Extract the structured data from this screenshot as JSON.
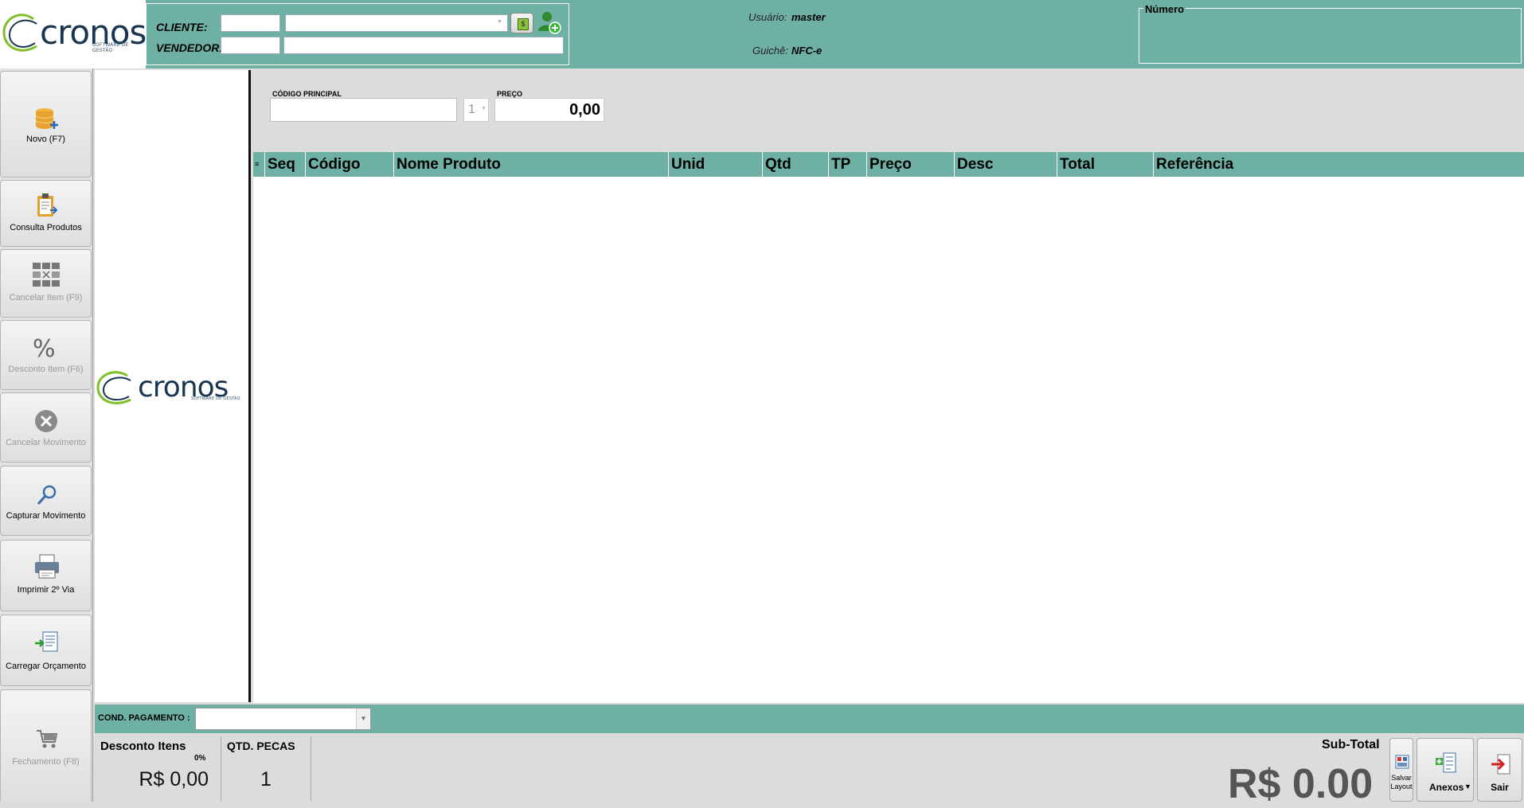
{
  "brand": {
    "name": "cronos",
    "tagline": "SOFTWARE DE GESTÃO"
  },
  "header": {
    "cliente_label": "CLIENTE:",
    "vendedor_label": "VENDEDOR:",
    "cliente_code": "",
    "cliente_name": "",
    "vendedor_code": "",
    "vendedor_name": "",
    "usuario_label": "Usuário:",
    "usuario_value": "master",
    "guiche_label": "Guichê:",
    "guiche_value": "NFC-e",
    "numero_label": "Número",
    "numero_value": ""
  },
  "sidebar": {
    "items": [
      {
        "label": "Novo (F7)",
        "icon": "database-add-icon",
        "enabled": true
      },
      {
        "label": "Consulta Produtos",
        "icon": "clipboard-icon",
        "enabled": true
      },
      {
        "label": "Cancelar Item (F9)",
        "icon": "grid-cancel-icon",
        "enabled": false
      },
      {
        "label": "Desconto Item (F6)",
        "icon": "percent-icon",
        "enabled": false
      },
      {
        "label": "Cancelar Movimento",
        "icon": "cancel-circle-icon",
        "enabled": false
      },
      {
        "label": "Capturar Movimento",
        "icon": "magnifier-icon",
        "enabled": true
      },
      {
        "label": "Imprimir 2º Via",
        "icon": "printer-icon",
        "enabled": true
      },
      {
        "label": "Carregar Orçamento",
        "icon": "document-load-icon",
        "enabled": true
      },
      {
        "label": "Fechamento (F8)",
        "icon": "cart-icon",
        "enabled": false
      }
    ]
  },
  "entry": {
    "codigo_label": "CÓDIGO PRINCIPAL",
    "codigo_value": "",
    "qty_value": "1",
    "preco_label": "PREÇO",
    "preco_value": "0,00"
  },
  "grid": {
    "columns": [
      "Seq",
      "Código",
      "Nome Produto",
      "Unid",
      "Qtd",
      "TP",
      "Preço",
      "Desc",
      "Total",
      "Referência"
    ],
    "rows": []
  },
  "payment": {
    "label": "COND. PAGAMENTO :",
    "value": ""
  },
  "totals": {
    "desconto_label": "Desconto Itens",
    "desconto_pct": "0%",
    "desconto_value": "R$ 0,00",
    "qtd_label": "QTD. PECAS",
    "qtd_value": "1",
    "subtotal_label": "Sub-Total",
    "subtotal_value": "R$ 0.00"
  },
  "actions": {
    "salvar_layout": "Salvar Layout",
    "anexos": "Anexos",
    "sair": "Sair"
  },
  "colors": {
    "teal": "#6fb0a4",
    "brand_navy": "#1a3550",
    "brand_green": "#7fbf2a"
  }
}
